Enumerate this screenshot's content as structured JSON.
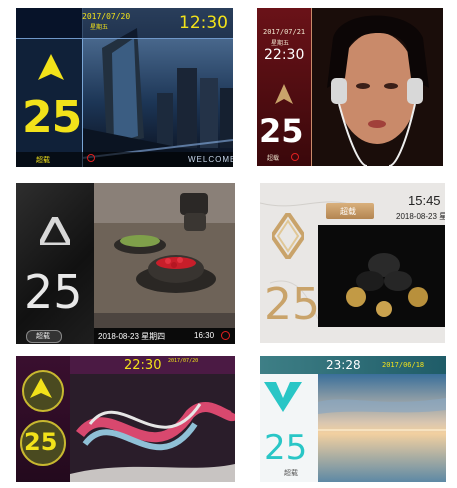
{
  "panels": [
    {
      "date": "2017/07/20",
      "weekday": "星期五",
      "time": "12:30",
      "floor": "25",
      "status": "超载",
      "footer": "WELCOME",
      "direction_icon": "up-arrow-icon"
    },
    {
      "date": "2017/07/21",
      "weekday": "星期五",
      "time": "22:30",
      "floor": "25",
      "status": "超载",
      "direction_icon": "up-arrow-icon"
    },
    {
      "floor": "25",
      "status": "超载",
      "datetime": "2018-08-23 星期四",
      "time": "16:30",
      "direction_icon": "up-arrow-icon"
    },
    {
      "status": "超载",
      "time": "15:45",
      "datetime": "2018-08-23 星期",
      "floor": "25",
      "direction_icon": "diamond-arrow-icon"
    },
    {
      "time": "22:30",
      "date": "2017/07/20",
      "floor": "25",
      "direction_icon": "up-arrow-icon"
    },
    {
      "time": "23:28",
      "date": "2017/06/18",
      "floor": "25",
      "status": "超载",
      "direction_icon": "v-arrow-icon"
    }
  ],
  "colors": {
    "yellow": "#f2e21a",
    "dark_red": "#5a0d12",
    "teal": "#29c6c6",
    "gold": "#c9a36a"
  }
}
